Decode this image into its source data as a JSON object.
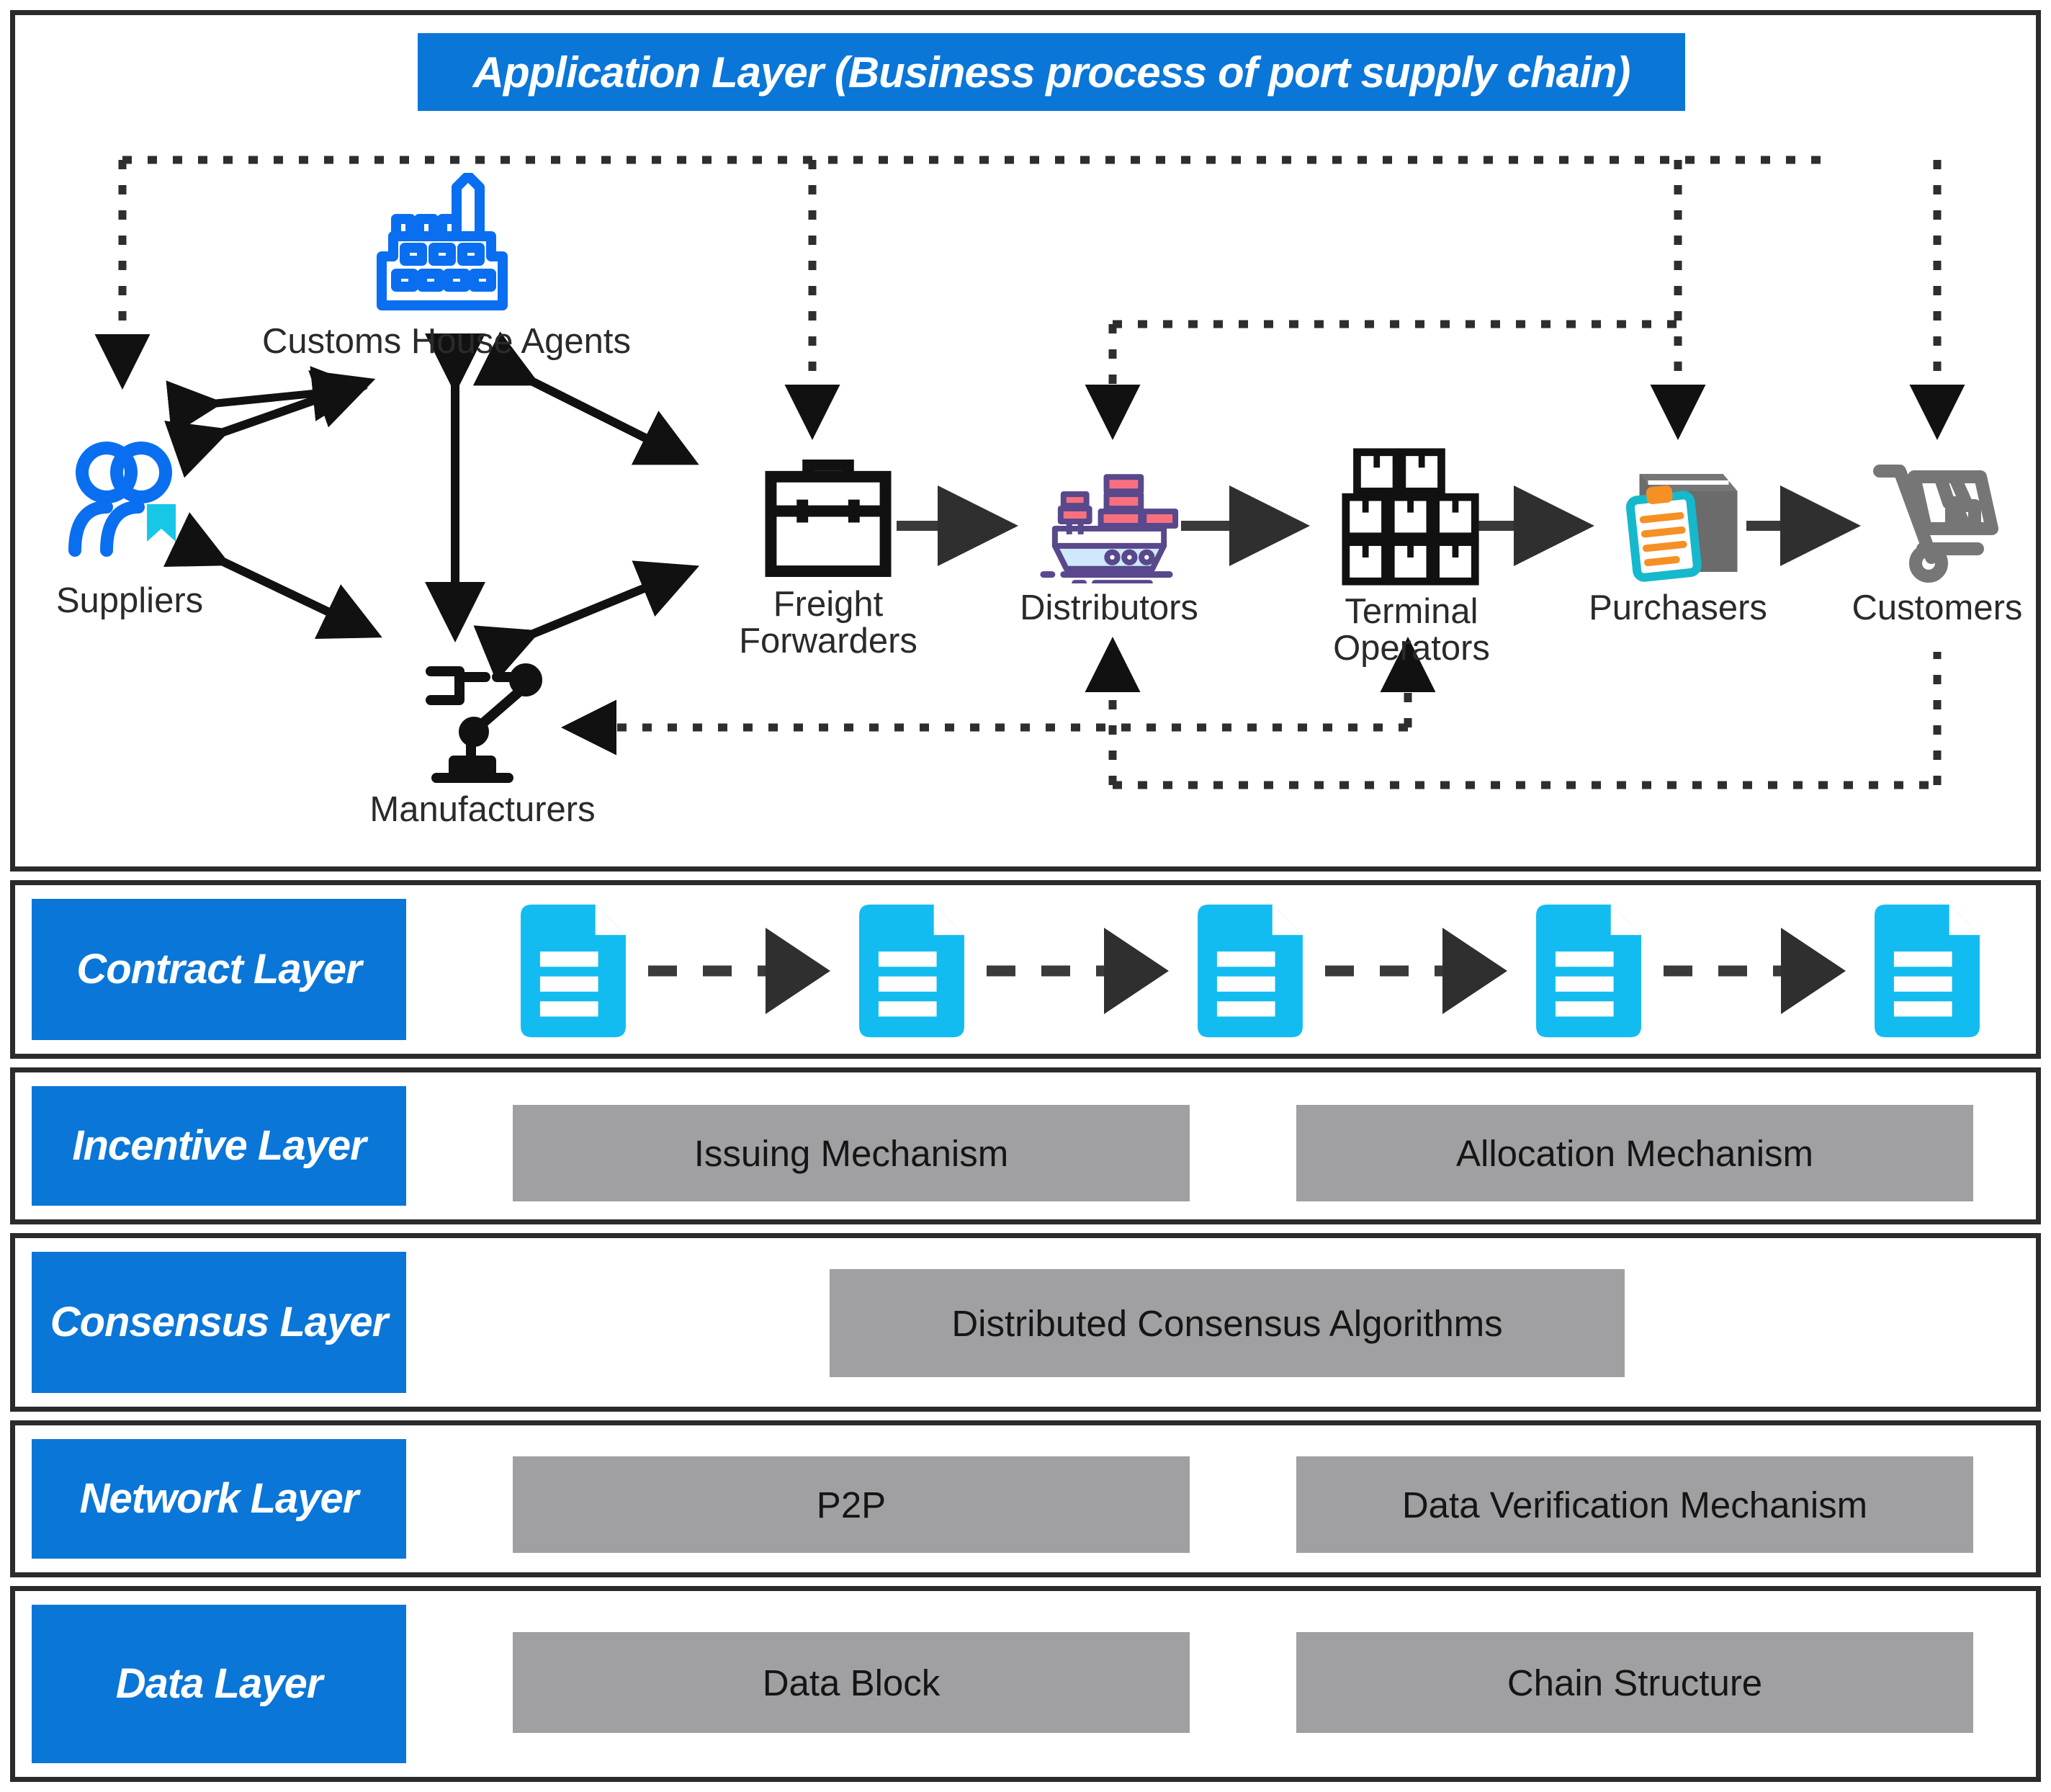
{
  "application_layer": {
    "title": "Application Layer (Business process of port supply chain)",
    "nodes": [
      {
        "id": "suppliers",
        "label": "Suppliers",
        "icon": "two-people-icon"
      },
      {
        "id": "customs",
        "label": "Customs House Agents",
        "icon": "factory-icon"
      },
      {
        "id": "manufacturers",
        "label": "Manufacturers",
        "icon": "robot-arm-icon"
      },
      {
        "id": "freight",
        "label": "Freight\nForwarders",
        "icon": "briefcase-icon"
      },
      {
        "id": "distributors",
        "label": "Distributors",
        "icon": "cargo-ship-icon"
      },
      {
        "id": "terminal",
        "label": "Terminal\nOperators",
        "icon": "stacked-boxes-icon"
      },
      {
        "id": "purchasers",
        "label": "Purchasers",
        "icon": "box-clipboard-icon"
      },
      {
        "id": "customers",
        "label": "Customers",
        "icon": "hand-truck-icon"
      }
    ]
  },
  "contract_layer": {
    "label": "Contract\nLayer",
    "documents": [
      {
        "id": "doc1",
        "icon": "document-icon"
      },
      {
        "id": "doc2",
        "icon": "document-icon"
      },
      {
        "id": "doc3",
        "icon": "document-icon"
      },
      {
        "id": "doc4",
        "icon": "document-icon"
      },
      {
        "id": "doc5",
        "icon": "document-icon"
      }
    ]
  },
  "incentive_layer": {
    "label": "Incentive Layer",
    "boxes": [
      {
        "id": "issuing",
        "label": "Issuing Mechanism"
      },
      {
        "id": "allocation",
        "label": "Allocation Mechanism"
      }
    ]
  },
  "consensus_layer": {
    "label": "Consensus\nLayer",
    "boxes": [
      {
        "id": "consensus_alg",
        "label": "Distributed Consensus Algorithms"
      }
    ]
  },
  "network_layer": {
    "label": "Network\nLayer",
    "boxes": [
      {
        "id": "p2p",
        "label": "P2P"
      },
      {
        "id": "dataverify",
        "label": "Data Verification Mechanism"
      }
    ]
  },
  "data_layer": {
    "label": "Data\nLayer",
    "boxes": [
      {
        "id": "datablock",
        "label": "Data Block"
      },
      {
        "id": "chainstruct",
        "label": "Chain Structure"
      }
    ]
  },
  "colors": {
    "brand_blue": "#0a76d8",
    "doc_cyan": "#13bcf0",
    "gray_box": "#a0a0a2",
    "border_dark": "#2b2b2b",
    "arrow_black": "#111111",
    "supplier_blue": "#0a6ef0",
    "bookmark_cyan": "#16c7e8"
  }
}
